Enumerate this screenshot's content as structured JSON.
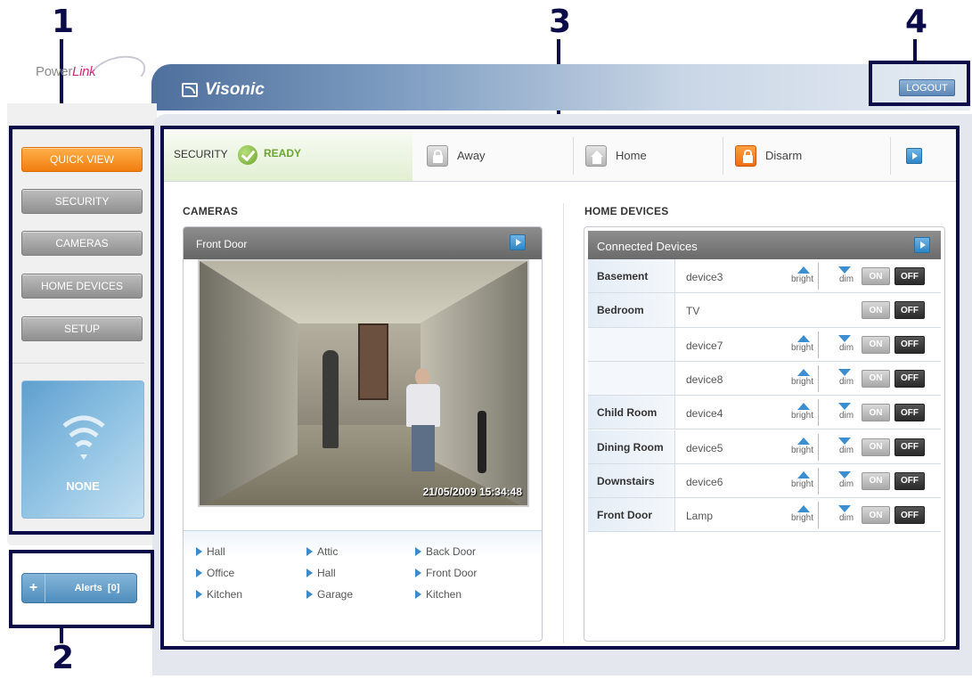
{
  "callouts": [
    "1",
    "2",
    "3",
    "4"
  ],
  "logo": {
    "text_gray": "Power",
    "text_pink": "Link"
  },
  "brand": {
    "name": "Visonic"
  },
  "header": {
    "logout_label": "LOGOUT"
  },
  "sidebar": {
    "items": [
      {
        "label": "QUICK VIEW",
        "active": true
      },
      {
        "label": "SECURITY",
        "active": false
      },
      {
        "label": "CAMERAS",
        "active": false
      },
      {
        "label": "HOME DEVICES",
        "active": false
      },
      {
        "label": "SETUP",
        "active": false
      }
    ],
    "status": {
      "icon": "wifi-icon",
      "label": "NONE"
    }
  },
  "alerts": {
    "plus": "+",
    "label": "Alerts",
    "count": "[0]"
  },
  "security_bar": {
    "label": "SECURITY",
    "state": "READY",
    "actions": [
      {
        "label": "Away",
        "icon": "lock-closed-icon"
      },
      {
        "label": "Home",
        "icon": "house-icon"
      },
      {
        "label": "Disarm",
        "icon": "lock-open-icon"
      }
    ]
  },
  "cameras": {
    "title": "CAMERAS",
    "current": "Front Door",
    "timestamp": "21/05/2009 15:34:48",
    "links": [
      "Hall",
      "Office",
      "Kitchen",
      "Attic",
      "Hall",
      "Garage",
      "Back Door",
      "Front Door",
      "Kitchen"
    ]
  },
  "home_devices": {
    "title": "HOME DEVICES",
    "panel_title": "Connected Devices",
    "control_labels": {
      "bright": "bright",
      "dim": "dim",
      "on": "ON",
      "off": "OFF"
    },
    "rows": [
      {
        "room": "Basement",
        "device": "device3",
        "dimmable": true
      },
      {
        "room": "Bedroom",
        "device": "TV",
        "dimmable": false
      },
      {
        "room": "",
        "device": "device7",
        "dimmable": true
      },
      {
        "room": "",
        "device": "device8",
        "dimmable": true
      },
      {
        "room": "Child Room",
        "device": "device4",
        "dimmable": true
      },
      {
        "room": "Dining Room",
        "device": "device5",
        "dimmable": true
      },
      {
        "room": "Downstairs",
        "device": "device6",
        "dimmable": true
      },
      {
        "room": "Front Door",
        "device": "Lamp",
        "dimmable": true
      }
    ]
  },
  "colors": {
    "accent_orange": "#f07d10",
    "brand_blue": "#4e6f9c",
    "ready_green": "#6aa52f",
    "callout_navy": "#0b0b4a"
  }
}
